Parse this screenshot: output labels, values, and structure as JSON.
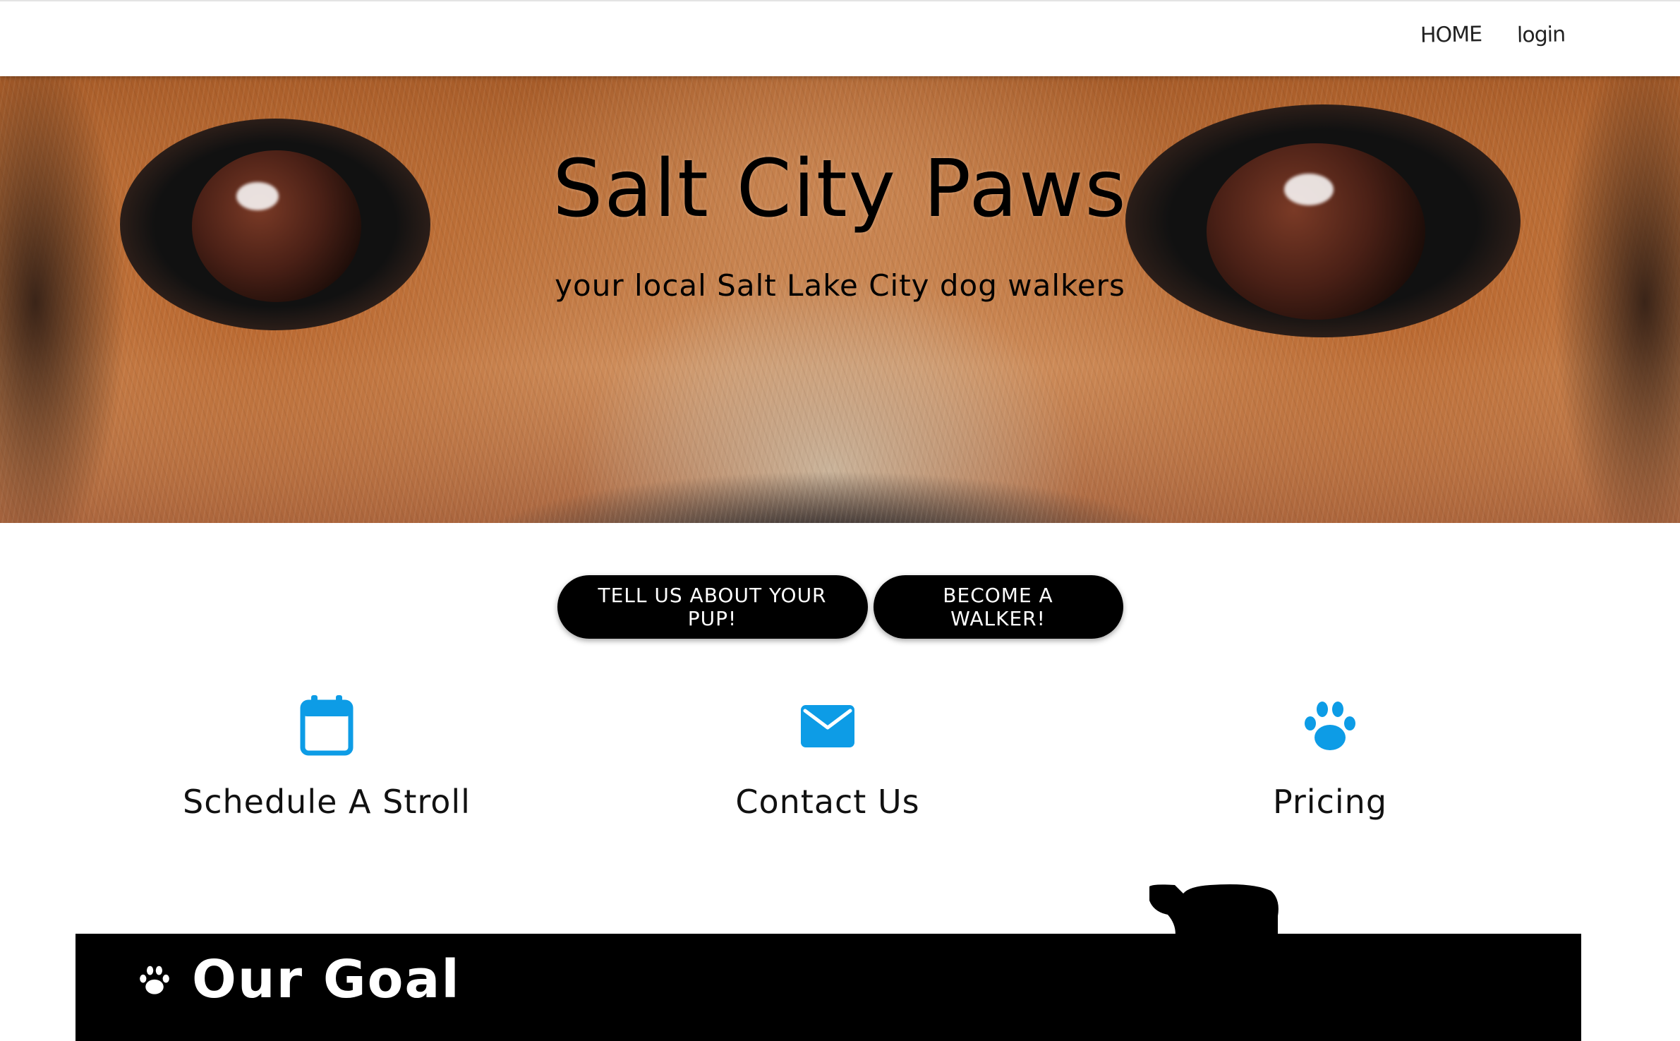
{
  "nav": {
    "home_label": "HOME",
    "login_label": "login"
  },
  "hero": {
    "title": "Salt City Paws",
    "subtitle": "your local Salt Lake City dog walkers"
  },
  "cta": {
    "pup_label": "TELL US ABOUT YOUR PUP!",
    "walker_label": "BECOME A WALKER!"
  },
  "features": {
    "schedule": {
      "label": "Schedule A Stroll",
      "icon": "calendar-icon"
    },
    "contact": {
      "label": "Contact Us",
      "icon": "envelope-icon"
    },
    "pricing": {
      "label": "Pricing",
      "icon": "paw-icon"
    }
  },
  "goal": {
    "title": "Our Goal",
    "icon": "paw-icon"
  },
  "colors": {
    "accent": "#0d9ce6",
    "button_bg": "#000000",
    "button_text": "#ffffff",
    "section_bg": "#000000"
  }
}
